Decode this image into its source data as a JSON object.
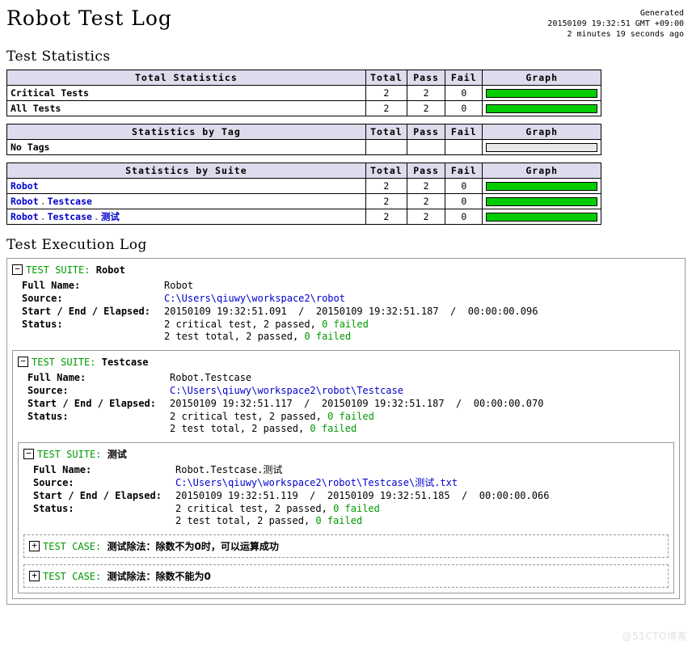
{
  "header": {
    "title": "Robot Test Log",
    "generated_label": "Generated",
    "generated_time": "20150109 19:32:51 GMT +09:00",
    "generated_ago": "2 minutes 19 seconds ago"
  },
  "sections": {
    "statistics_title": "Test Statistics",
    "execution_title": "Test Execution Log"
  },
  "colors": {
    "pass_green": "#00cc00",
    "fail_red": "#ff3333",
    "header_bg": "#dcdcec",
    "link_blue": "#0000cc",
    "ok_text": "#009900",
    "empty_bar": "#e8e8e8"
  },
  "columns": {
    "total": "Total",
    "pass": "Pass",
    "fail": "Fail",
    "graph": "Graph"
  },
  "tables": [
    {
      "id": "total-statistics",
      "title": "Total Statistics",
      "rows": [
        {
          "name": "Critical Tests",
          "total": "2",
          "pass": "2",
          "fail": "0",
          "pass_pct": 100,
          "fail_pct": 0,
          "empty": false
        },
        {
          "name": "All Tests",
          "total": "2",
          "pass": "2",
          "fail": "0",
          "pass_pct": 100,
          "fail_pct": 0,
          "empty": false
        }
      ]
    },
    {
      "id": "statistics-by-tag",
      "title": "Statistics by Tag",
      "rows": [
        {
          "name": "No Tags",
          "total": "",
          "pass": "",
          "fail": "",
          "pass_pct": 0,
          "fail_pct": 0,
          "empty": true
        }
      ]
    },
    {
      "id": "statistics-by-suite",
      "title": "Statistics by Suite",
      "rows": [
        {
          "name": "Robot",
          "link_parts": [
            "Robot"
          ],
          "total": "2",
          "pass": "2",
          "fail": "0",
          "pass_pct": 100,
          "fail_pct": 0,
          "empty": false
        },
        {
          "name": "Robot . Testcase",
          "link_parts": [
            "Robot",
            "Testcase"
          ],
          "total": "2",
          "pass": "2",
          "fail": "0",
          "pass_pct": 100,
          "fail_pct": 0,
          "empty": false
        },
        {
          "name": "Robot . Testcase . 测试",
          "link_parts": [
            "Robot",
            "Testcase",
            "测试"
          ],
          "total": "2",
          "pass": "2",
          "fail": "0",
          "pass_pct": 100,
          "fail_pct": 0,
          "empty": false
        }
      ]
    }
  ],
  "meta_labels": {
    "full_name": "Full Name:",
    "source": "Source:",
    "start_end_elapsed": "Start / End / Elapsed:",
    "status": "Status:"
  },
  "suites": [
    {
      "type_label": "TEST SUITE:",
      "name": "Robot",
      "toggle": "−",
      "full_name": "Robot",
      "source": "C:\\Users\\qiuwy\\workspace2\\robot",
      "start": "20150109 19:32:51.091",
      "end": "20150109 19:32:51.187",
      "elapsed": "00:00:00.096",
      "status_critical_prefix": "2 critical test, 2 passed, ",
      "status_critical_failed": "0 failed",
      "status_total_prefix": "2 test total, 2 passed, ",
      "status_total_failed": "0 failed"
    },
    {
      "type_label": "TEST SUITE:",
      "name": "Testcase",
      "toggle": "−",
      "full_name": "Robot.Testcase",
      "source": "C:\\Users\\qiuwy\\workspace2\\robot\\Testcase",
      "start": "20150109 19:32:51.117",
      "end": "20150109 19:32:51.187",
      "elapsed": "00:00:00.070",
      "status_critical_prefix": "2 critical test, 2 passed, ",
      "status_critical_failed": "0 failed",
      "status_total_prefix": "2 test total, 2 passed, ",
      "status_total_failed": "0 failed"
    },
    {
      "type_label": "TEST SUITE:",
      "name": "测试",
      "toggle": "−",
      "full_name": "Robot.Testcase.测试",
      "source": "C:\\Users\\qiuwy\\workspace2\\robot\\Testcase\\测试.txt",
      "start": "20150109 19:32:51.119",
      "end": "20150109 19:32:51.185",
      "elapsed": "00:00:00.066",
      "status_critical_prefix": "2 critical test, 2 passed, ",
      "status_critical_failed": "0 failed",
      "status_total_prefix": "2 test total, 2 passed, ",
      "status_total_failed": "0 failed"
    }
  ],
  "test_cases": [
    {
      "type_label": "TEST CASE:",
      "toggle": "+",
      "name": "测试除法：除数不为0时，可以运算成功"
    },
    {
      "type_label": "TEST CASE:",
      "toggle": "+",
      "name": "测试除法：除数不能为0"
    }
  ],
  "separators": {
    "slash": "/",
    "dot": "."
  },
  "watermark": "@51CTO博客"
}
